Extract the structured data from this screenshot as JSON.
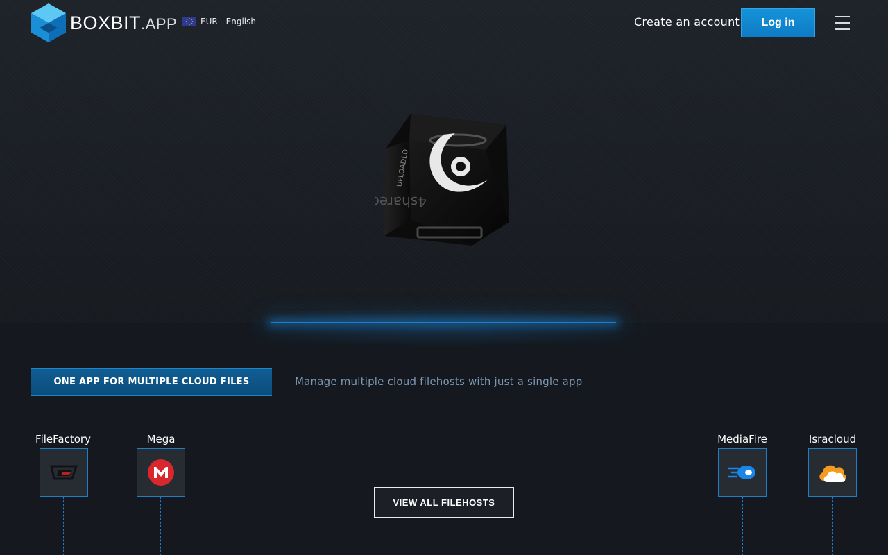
{
  "header": {
    "logo": {
      "brand": "BOXBIT",
      "suffix": ".APP"
    },
    "currency_label": "EUR - English",
    "create_account_label": "Create an account",
    "login_label": "Log in",
    "menu_icon": "hamburger-menu-icon"
  },
  "hero": {
    "cube_icon": "filehost-cube-illustration"
  },
  "feature": {
    "tag_label": "ONE APP FOR MULTIPLE CLOUD FILES",
    "description": "Manage multiple cloud filehosts with just a single app"
  },
  "filehosts": [
    {
      "name": "FileFactory",
      "icon": "filefactory-logo-icon"
    },
    {
      "name": "Mega",
      "icon": "mega-logo-icon"
    },
    {
      "name": "MediaFire",
      "icon": "mediafire-logo-icon"
    },
    {
      "name": "Isracloud",
      "icon": "isracloud-logo-icon"
    }
  ],
  "view_all_label": "VIEW ALL FILEHOSTS",
  "colors": {
    "accent": "#1692d8",
    "background": "#15191f",
    "feature_text": "#7d97b3",
    "host_border": "#1f7fc4"
  }
}
